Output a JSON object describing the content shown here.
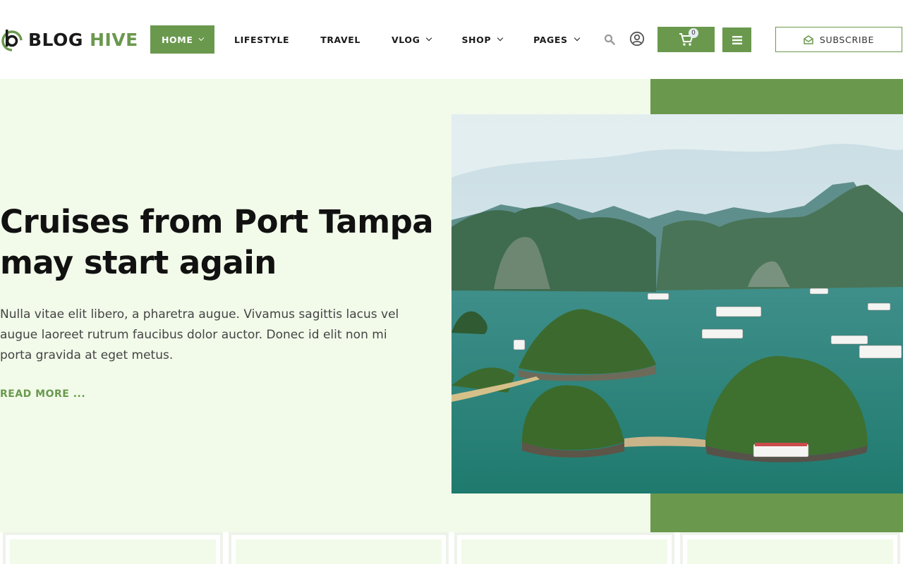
{
  "brand": {
    "part1": "BLOG",
    "part2": "HIVE"
  },
  "nav": {
    "items": [
      {
        "label": "HOME",
        "active": true,
        "dropdown": true
      },
      {
        "label": "LIFESTYLE",
        "active": false,
        "dropdown": false
      },
      {
        "label": "TRAVEL",
        "active": false,
        "dropdown": false
      },
      {
        "label": "VLOG",
        "active": false,
        "dropdown": true
      },
      {
        "label": "SHOP",
        "active": false,
        "dropdown": true
      },
      {
        "label": "PAGES",
        "active": false,
        "dropdown": true
      }
    ]
  },
  "header": {
    "cart_count": "0",
    "subscribe_label": "SUBSCRIBE"
  },
  "hero": {
    "title": "Cruises from Port Tampa may start again",
    "description": "Nulla vitae elit libero, a pharetra augue. Vivamus sagittis lacus vel augue laoreet rutrum faucibus dolor auctor. Donec id elit non mi porta gravida at eget metus.",
    "read_more": "READ MORE ..."
  },
  "colors": {
    "accent": "#6a994e",
    "hero_bg": "#f2fbea",
    "text": "#111111"
  },
  "icons": [
    "logo-icon",
    "chevron-down-icon",
    "search-icon",
    "user-icon",
    "cart-icon",
    "hamburger-icon",
    "envelope-icon"
  ]
}
